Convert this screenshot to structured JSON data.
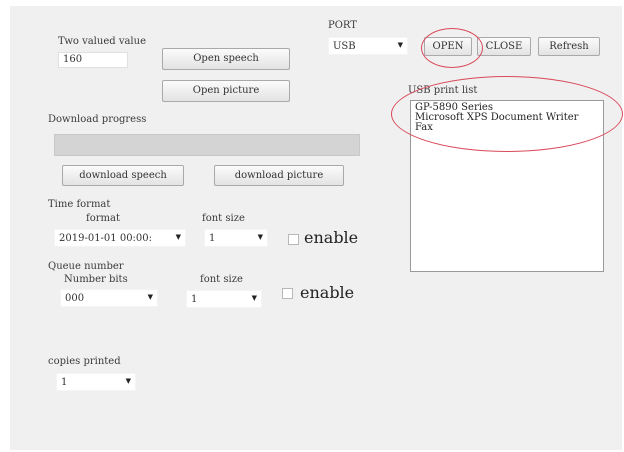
{
  "port": {
    "label": "PORT",
    "selected": "USB",
    "open_label": "OPEN",
    "close_label": "CLOSE",
    "refresh_label": "Refresh"
  },
  "two_valued": {
    "label": "Two valued value",
    "value": "160"
  },
  "buttons": {
    "open_speech": "Open speech",
    "open_picture": "Open picture",
    "download_speech": "download speech",
    "download_picture": "download picture"
  },
  "download": {
    "label": "Download progress",
    "progress": 0
  },
  "time_format": {
    "label": "Time format",
    "format_label": "format",
    "format_value": "2019-01-01 00:00:",
    "font_size_label": "font size",
    "font_size_value": "1",
    "enable_label": "enable",
    "enabled": false
  },
  "queue": {
    "label": "Queue number",
    "bits_label": "Number bits",
    "bits_value": "000",
    "font_size_label": "font size",
    "font_size_value": "1",
    "enable_label": "enable",
    "enabled": false
  },
  "copies": {
    "label": "copies printed",
    "value": "1"
  },
  "usb_list": {
    "label": "USB print list",
    "items": [
      "GP-5890 Series",
      "Microsoft XPS Document Writer",
      "Fax"
    ]
  },
  "annotation_color": "#d94a5a"
}
